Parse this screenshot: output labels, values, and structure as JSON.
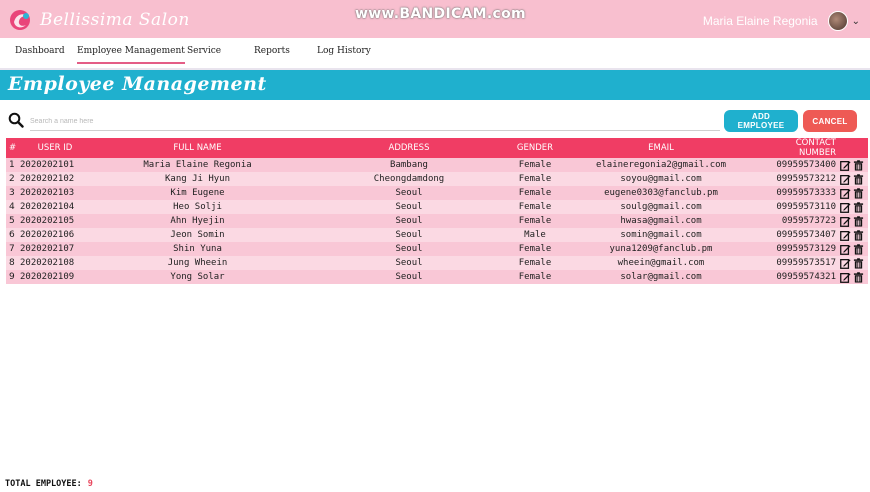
{
  "app": {
    "brand_name": "Bellissima Salon",
    "watermark": "www.BANDICAM.com"
  },
  "user": {
    "name": "Maria Elaine Regonia"
  },
  "nav": {
    "items": [
      {
        "label": "Dashboard"
      },
      {
        "label": "Employee Management",
        "active": true
      },
      {
        "label": "Service"
      },
      {
        "label": "Reports"
      },
      {
        "label": "Log History"
      }
    ]
  },
  "page": {
    "title": "Employee Management"
  },
  "search": {
    "placeholder": "Search a name here",
    "value": ""
  },
  "buttons": {
    "add": "ADD EMPLOYEE",
    "cancel": "CANCEL"
  },
  "table": {
    "columns": [
      "#",
      "USER ID",
      "FULL NAME",
      "ADDRESS",
      "GENDER",
      "EMAIL",
      "CONTACT NUMBER"
    ],
    "rows": [
      {
        "num": "1",
        "user_id": "2020202101",
        "full_name": "Maria Elaine Regonia",
        "address": "Bambang",
        "gender": "Female",
        "email": "elaineregonia2@gmail.com",
        "contact": "09959573400"
      },
      {
        "num": "2",
        "user_id": "2020202102",
        "full_name": "Kang Ji Hyun",
        "address": "Cheongdamdong",
        "gender": "Female",
        "email": "soyou@gmail.com",
        "contact": "09959573212"
      },
      {
        "num": "3",
        "user_id": "2020202103",
        "full_name": "Kim Eugene",
        "address": "Seoul",
        "gender": "Female",
        "email": "eugene0303@fanclub.pm",
        "contact": "09959573333"
      },
      {
        "num": "4",
        "user_id": "2020202104",
        "full_name": "Heo Solji",
        "address": "Seoul",
        "gender": "Female",
        "email": "soulg@gmail.com",
        "contact": "09959573110"
      },
      {
        "num": "5",
        "user_id": "2020202105",
        "full_name": "Ahn Hyejin",
        "address": "Seoul",
        "gender": "Female",
        "email": "hwasa@gmail.com",
        "contact": "0959573723"
      },
      {
        "num": "6",
        "user_id": "2020202106",
        "full_name": "Jeon Somin",
        "address": "Seoul",
        "gender": "Male",
        "email": "somin@gmail.com",
        "contact": "09959573407"
      },
      {
        "num": "7",
        "user_id": "2020202107",
        "full_name": "Shin Yuna",
        "address": "Seoul",
        "gender": "Female",
        "email": "yuna1209@fanclub.pm",
        "contact": "09959573129"
      },
      {
        "num": "8",
        "user_id": "2020202108",
        "full_name": "Jung Wheein",
        "address": "Seoul",
        "gender": "Female",
        "email": "wheein@gmail.com",
        "contact": "09959573517"
      },
      {
        "num": "9",
        "user_id": "2020202109",
        "full_name": "Yong Solar",
        "address": "Seoul",
        "gender": "Female",
        "email": "solar@gmail.com",
        "contact": "09959574321"
      }
    ]
  },
  "footer": {
    "label": "TOTAL EMPLOYEE:",
    "count": "9"
  },
  "icons": {
    "brand": "salon-logo-icon",
    "search": "search-icon",
    "edit": "edit-icon",
    "delete": "trash-icon",
    "dropdown": "chevron-down-icon"
  },
  "colors": {
    "topbar": "#f8bfcf",
    "banner": "#1fb0ce",
    "table_header": "#f03d64",
    "add_button": "#1fb0ce",
    "cancel_button": "#ee5a55",
    "row_odd": "#f9c7d6",
    "row_even": "#fbd9e3"
  }
}
